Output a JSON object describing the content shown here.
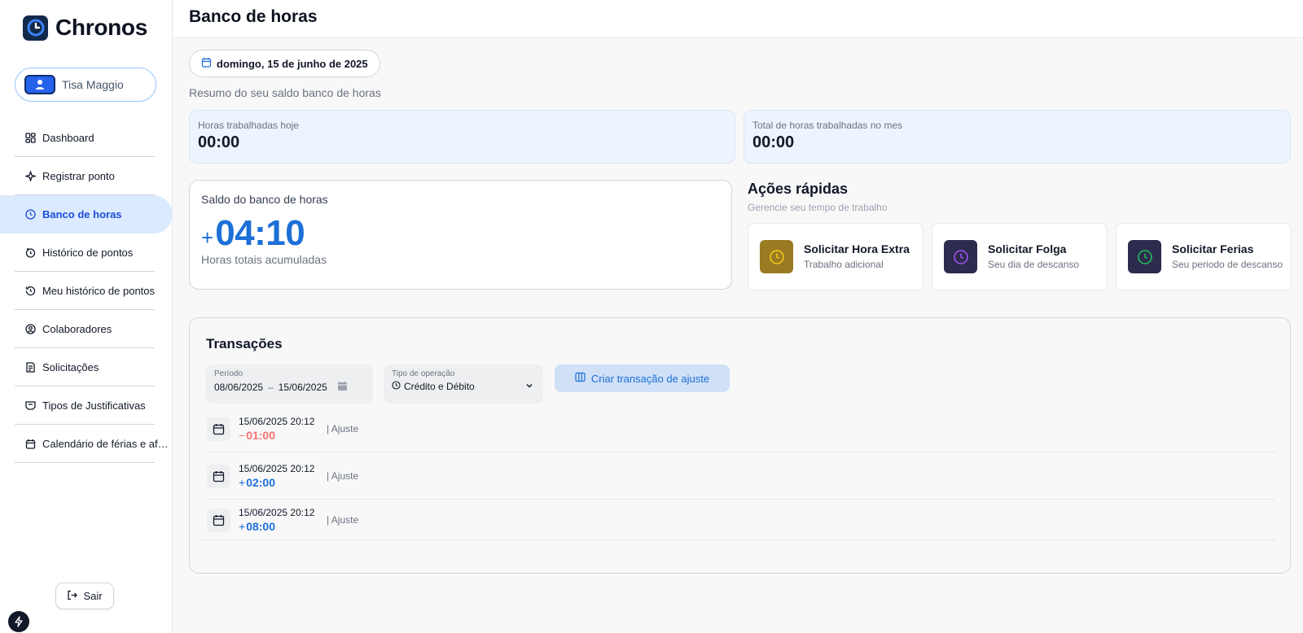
{
  "app": {
    "name": "Chronos"
  },
  "user": {
    "name": "Tisa Maggio"
  },
  "sidebar": {
    "items": [
      {
        "label": "Dashboard",
        "icon": "dashboard-icon"
      },
      {
        "label": "Registrar ponto",
        "icon": "sparkle-icon"
      },
      {
        "label": "Banco de horas",
        "icon": "clock-icon",
        "active": true
      },
      {
        "label": "Histórico de pontos",
        "icon": "history-clock-icon"
      },
      {
        "label": "Meu histórico de pontos",
        "icon": "history-icon"
      },
      {
        "label": "Colaboradores",
        "icon": "user-circle-icon"
      },
      {
        "label": "Solicitações",
        "icon": "document-icon"
      },
      {
        "label": "Tipos de Justificativas",
        "icon": "receipt-icon"
      },
      {
        "label": "Calendário de férias e af…",
        "icon": "calendar-icon"
      }
    ],
    "logout_label": "Sair"
  },
  "header": {
    "title": "Banco de horas"
  },
  "date_chip": "domingo, 15 de junho de 2025",
  "summary_subtitle": "Resumo do seu saldo banco de horas",
  "stats": {
    "today_label": "Horas trabalhadas hoje",
    "today_value": "00:00",
    "month_label": "Total de horas trabalhadas no mes",
    "month_value": "00:00"
  },
  "balance": {
    "title": "Saldo do banco de horas",
    "sign": "+",
    "value": "04:10",
    "caption": "Horas totais acumuladas"
  },
  "quick_actions": {
    "title": "Ações rápidas",
    "subtitle": "Gerencie seu tempo de trabalho",
    "items": [
      {
        "title": "Solicitar Hora Extra",
        "subtitle": "Trabalho adicional",
        "bg": "#9a7b22",
        "fg": "#facc15"
      },
      {
        "title": "Solicitar Folga",
        "subtitle": "Seu dia de descanso",
        "bg": "#2d2b4e",
        "fg": "#a855f7"
      },
      {
        "title": "Solicitar Ferias",
        "subtitle": "Seu periodo de descanso",
        "bg": "#2d2b4e",
        "fg": "#22c55e"
      }
    ]
  },
  "transactions": {
    "title": "Transações",
    "period_label": "Período",
    "period_from": "08/06/2025",
    "period_to": "15/06/2025",
    "type_label": "Tipo de operação",
    "type_value": "Crédito e Débito",
    "adjust_button": "Criar transação de ajuste",
    "rows": [
      {
        "date": "15/06/2025 20:12",
        "sign": "−",
        "amount": "01:00",
        "kind": "negative",
        "type": "| Ajuste"
      },
      {
        "date": "15/06/2025 20:12",
        "sign": "+",
        "amount": "02:00",
        "kind": "positive",
        "type": "| Ajuste"
      },
      {
        "date": "15/06/2025 20:12",
        "sign": "+",
        "amount": "08:00",
        "kind": "positive",
        "type": "| Ajuste"
      }
    ]
  },
  "colors": {
    "accent": "#1d6fd8",
    "active_nav_bg": "#dbeafe",
    "negative": "#f87171"
  }
}
